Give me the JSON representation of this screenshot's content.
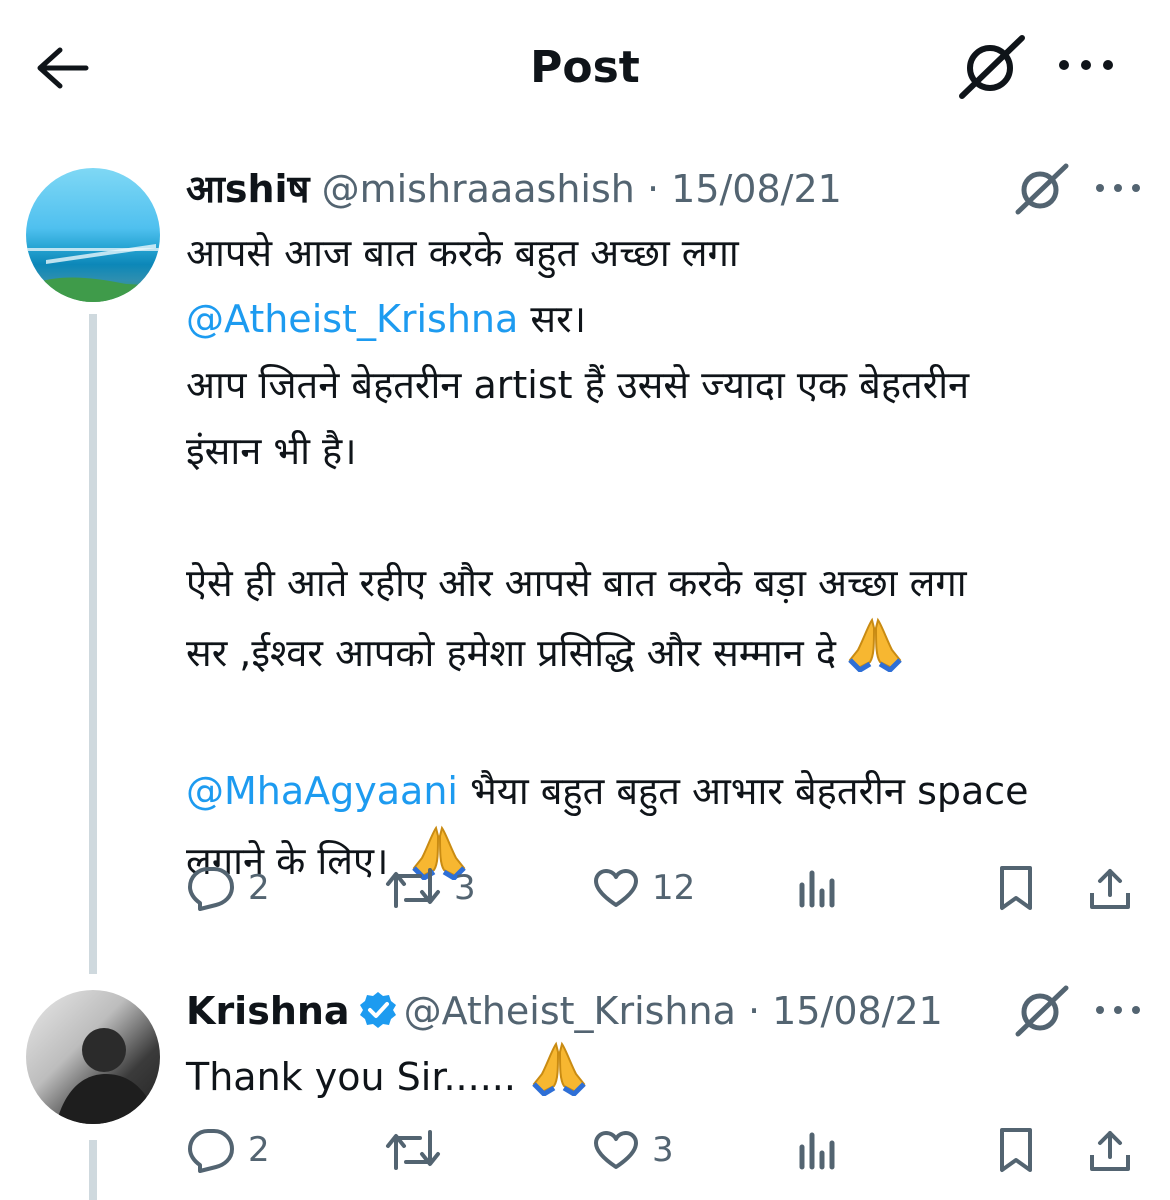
{
  "header": {
    "title": "Post"
  },
  "colors": {
    "accent": "#1d9bf0",
    "secondary_text": "#536471",
    "thread_line": "#cfd9de"
  },
  "icons": [
    "back-arrow-icon",
    "grok-icon",
    "more-icon",
    "reply-icon",
    "repost-icon",
    "like-icon",
    "views-icon",
    "bookmark-icon",
    "share-icon",
    "verified-badge-icon",
    "folded-hands-emoji"
  ],
  "tweets": [
    {
      "name": "आshiष",
      "handle": "@mishraaashish",
      "dot": "·",
      "date": "15/08/21",
      "body": {
        "l1": "आपसे आज बात करके बहुत अच्छा लगा",
        "mention1": "@Atheist_Krishna",
        "l2b": " सर।",
        "l3": "आप जितने बेहतरीन artist हैं उससे ज्यादा एक बेहतरीन",
        "l4": "इंसान भी है।",
        "l5": "ऐसे ही आते रहीए और आपसे बात करके बड़ा अच्छा लगा",
        "l6": "सर ,ईश्वर आपको हमेशा प्रसिद्धि और सम्मान दे",
        "mention2": "@MhaAgyaani",
        "l7b": " भैया बहुत बहुत आभार बेहतरीन space",
        "l8": "लगाने के लिए।"
      },
      "stats": {
        "replies": "2",
        "reposts": "3",
        "likes": "12"
      }
    },
    {
      "name": "Krishna",
      "handle": "@Atheist_Krishna",
      "dot": "·",
      "date": "15/08/21",
      "body": {
        "l1": "Thank you Sir......"
      },
      "stats": {
        "replies": "2",
        "reposts": "",
        "likes": "3"
      }
    }
  ]
}
